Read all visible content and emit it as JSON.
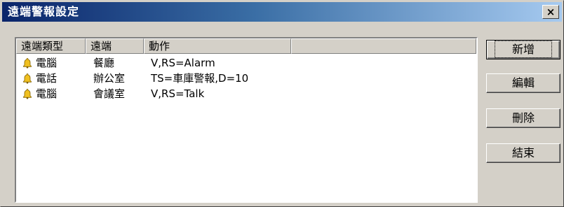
{
  "window": {
    "title": "遠端警報設定",
    "close_glyph": "×"
  },
  "list": {
    "columns": [
      "遠端類型",
      "遠端",
      "動作",
      ""
    ],
    "rows": [
      {
        "icon": "bell-icon",
        "type": "電腦",
        "remote": "餐廳",
        "action": "V,RS=Alarm"
      },
      {
        "icon": "bell-icon",
        "type": "電話",
        "remote": "辦公室",
        "action": "TS=車庫警報,D=10"
      },
      {
        "icon": "bell-icon",
        "type": "電腦",
        "remote": "會議室",
        "action": "V,RS=Talk"
      }
    ]
  },
  "buttons": {
    "add": "新增",
    "edit": "編輯",
    "delete": "刪除",
    "close": "結束"
  },
  "colors": {
    "title_start": "#0a246a",
    "title_end": "#a6caf0",
    "face": "#d4d0c8",
    "bell": "#f0c020"
  }
}
